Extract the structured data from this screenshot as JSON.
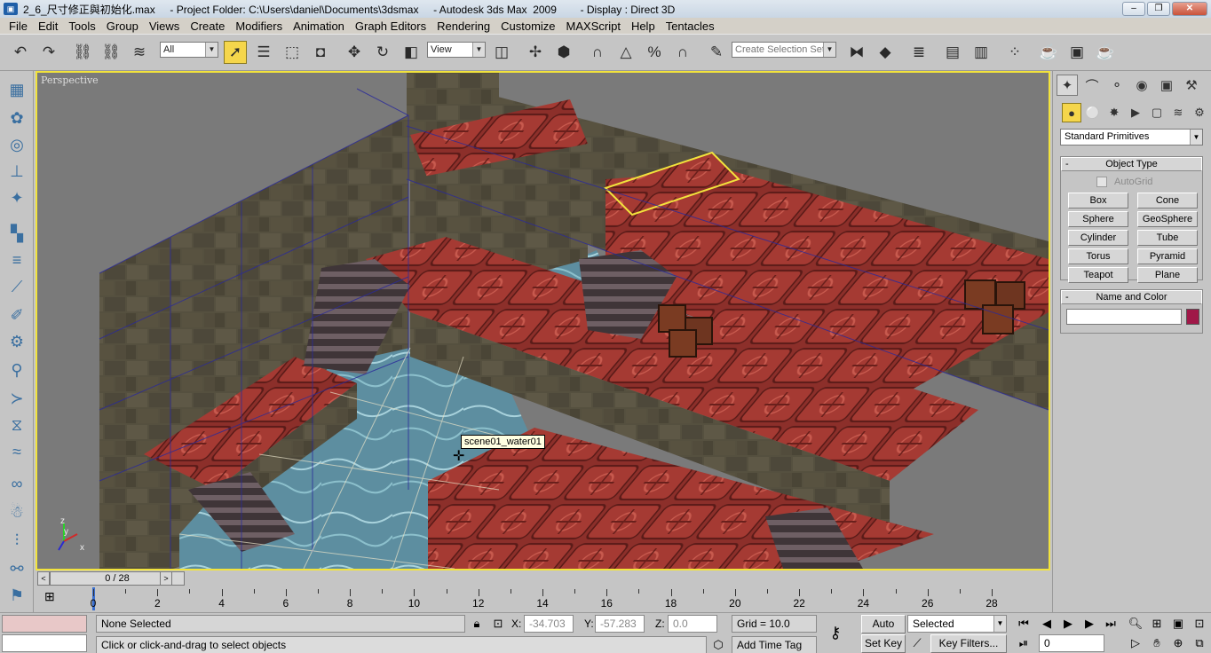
{
  "titlebar": {
    "text": "2_6_尺寸修正與初始化.max     - Project Folder: C:\\Users\\daniel\\Documents\\3dsmax     - Autodesk 3ds Max  2009        - Display : Direct 3D"
  },
  "menu": [
    "File",
    "Edit",
    "Tools",
    "Group",
    "Views",
    "Create",
    "Modifiers",
    "Animation",
    "Graph Editors",
    "Rendering",
    "Customize",
    "MAXScript",
    "Help",
    "Tentacles"
  ],
  "toolbar": {
    "selection_filter": "All",
    "ref_coord": "View",
    "named_selection_placeholder": "Create Selection Set"
  },
  "viewport": {
    "label": "Perspective",
    "tooltip": "scene01_water01",
    "axes": {
      "x": "x",
      "y": "y",
      "z": "z"
    }
  },
  "command_panel": {
    "category": "Standard Primitives",
    "object_type_title": "Object Type",
    "autogrid_label": "AutoGrid",
    "buttons": [
      "Box",
      "Cone",
      "Sphere",
      "GeoSphere",
      "Cylinder",
      "Tube",
      "Torus",
      "Pyramid",
      "Teapot",
      "Plane"
    ],
    "name_color_title": "Name and Color",
    "name_value": "",
    "color": "#a01848"
  },
  "timeslider": {
    "position": "0 / 28",
    "prev": "<",
    "next": ">"
  },
  "trackbar": {
    "labels": [
      "0",
      "2",
      "4",
      "6",
      "8",
      "10",
      "12",
      "14",
      "16",
      "18",
      "20",
      "22",
      "24",
      "26",
      "28"
    ]
  },
  "status": {
    "selection": "None Selected",
    "prompt": "Click or click-and-drag to select objects",
    "x_label": "X:",
    "x_value": "-34.703",
    "y_label": "Y:",
    "y_value": "-57.283",
    "z_label": "Z:",
    "z_value": "0.0",
    "grid": "Grid = 10.0",
    "add_time_tag": "Add Time Tag",
    "auto_key": "Auto Key",
    "set_key": "Set Key",
    "key_mode": "Selected",
    "key_filters": "Key Filters...",
    "current_frame": "0"
  }
}
